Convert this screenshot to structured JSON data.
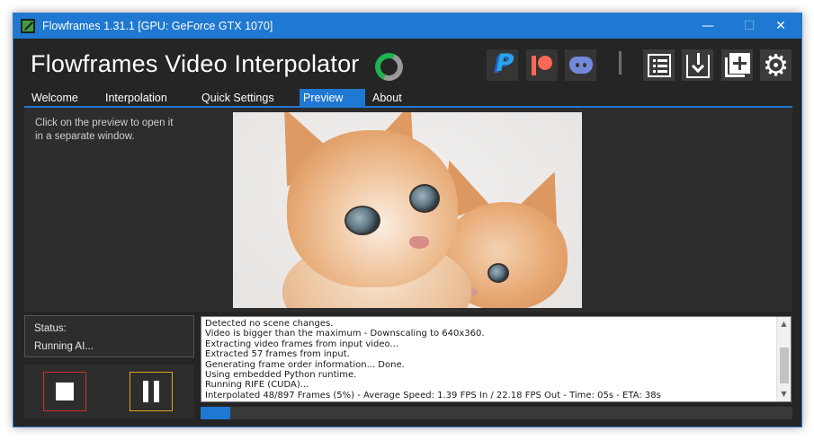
{
  "window": {
    "title": "Flowframes 1.31.1 [GPU: GeForce GTX 1070]"
  },
  "window_controls": {
    "minimize": "—",
    "maximize": "☐",
    "close": "✕"
  },
  "header": {
    "app_title": "Flowframes Video Interpolator",
    "icons": [
      "paypal-icon",
      "patreon-icon",
      "discord-icon",
      "list-icon",
      "download-icon",
      "add-to-queue-icon",
      "gear-icon"
    ]
  },
  "tabs": [
    {
      "label": "Welcome"
    },
    {
      "label": "Interpolation"
    },
    {
      "label": "Quick Settings"
    },
    {
      "label": "Preview",
      "active": true
    },
    {
      "label": "About"
    }
  ],
  "preview_tab": {
    "hint": "Click on the preview to open it in a separate window."
  },
  "status": {
    "label": "Status:",
    "value": "Running AI..."
  },
  "log": {
    "lines": [
      "Detected no scene changes.",
      "Video is bigger than the maximum - Downscaling to 640x360.",
      "Extracting video frames from input video...",
      "Extracted 57 frames from input.",
      "Generating frame order information... Done.",
      "Using embedded Python runtime.",
      "Running RIFE (CUDA)...",
      "Interpolated 48/897 Frames (5%) - Average Speed: 1.39 FPS In / 22.18 FPS Out - Time: 05s - ETA: 38s"
    ]
  },
  "progress": {
    "percent": 5
  },
  "colors": {
    "accent": "#1f78d1",
    "background": "#252525",
    "panel": "#2d2d2d",
    "stop_border": "#d03030",
    "pause_border": "#e0a020"
  }
}
